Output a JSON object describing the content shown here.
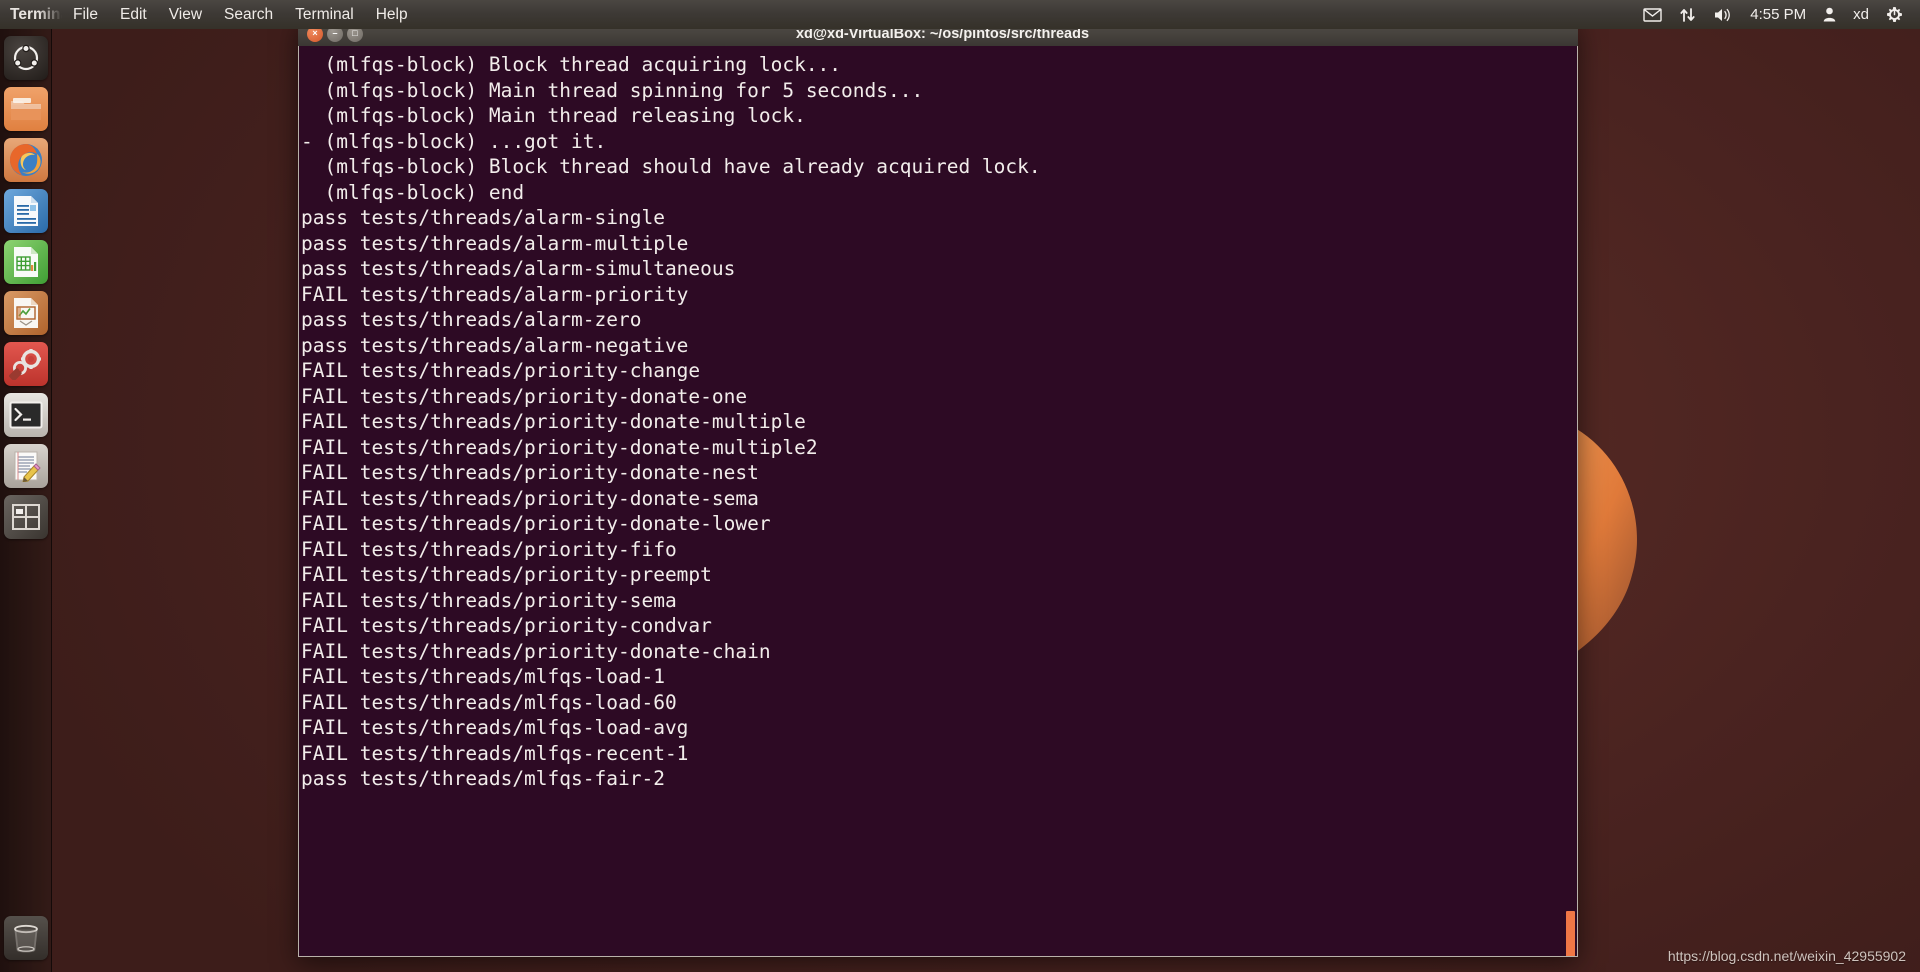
{
  "top_panel": {
    "app_name": "Terminal",
    "menus": [
      {
        "label": "File",
        "name": "menu-file"
      },
      {
        "label": "Edit",
        "name": "menu-edit"
      },
      {
        "label": "View",
        "name": "menu-view"
      },
      {
        "label": "Search",
        "name": "menu-search"
      },
      {
        "label": "Terminal",
        "name": "menu-terminal"
      },
      {
        "label": "Help",
        "name": "menu-help"
      }
    ],
    "tray": {
      "mail_icon": "envelope-icon",
      "network_icon": "network-updown-icon",
      "volume_icon": "volume-speaker-icon",
      "clock": "4:55 PM",
      "user_icon": "user-icon",
      "username": "xd",
      "session_icon": "gear-power-icon"
    }
  },
  "launcher": {
    "items": [
      {
        "name": "dash-home",
        "icon": "ubuntu-logo-icon",
        "label": "Dash Home"
      },
      {
        "name": "files",
        "icon": "folder-icon",
        "label": "Files"
      },
      {
        "name": "firefox",
        "icon": "firefox-icon",
        "label": "Firefox Web Browser"
      },
      {
        "name": "libreoffice-writer",
        "icon": "document-writer-icon",
        "label": "LibreOffice Writer"
      },
      {
        "name": "libreoffice-calc",
        "icon": "spreadsheet-calc-icon",
        "label": "LibreOffice Calc"
      },
      {
        "name": "libreoffice-impress",
        "icon": "presentation-impress-icon",
        "label": "LibreOffice Impress"
      },
      {
        "name": "system-settings",
        "icon": "gear-wrench-icon",
        "label": "System Settings"
      },
      {
        "name": "terminal",
        "icon": "terminal-prompt-icon",
        "label": "Terminal",
        "running": true,
        "focused": true
      },
      {
        "name": "text-editor",
        "icon": "pencil-document-icon",
        "label": "Text Editor",
        "running": true
      },
      {
        "name": "workspace-switcher",
        "icon": "workspace-grid-icon",
        "label": "Workspace Switcher"
      }
    ],
    "trash": {
      "name": "trash",
      "icon": "trash-bin-icon",
      "label": "Trash"
    }
  },
  "terminal": {
    "title": "xd@xd-VirtualBox: ~/os/pintos/src/threads",
    "buttons": {
      "close": "×",
      "minimize": "–",
      "maximize": "□"
    },
    "background_color": "#2d0a24",
    "text_color": "#f2edeb",
    "scrollbar_color": "#f07746",
    "lines": [
      "  (mlfqs-block) Block thread acquiring lock...",
      "  (mlfqs-block) Main thread spinning for 5 seconds...",
      "  (mlfqs-block) Main thread releasing lock.",
      "- (mlfqs-block) ...got it.",
      "  (mlfqs-block) Block thread should have already acquired lock.",
      "  (mlfqs-block) end",
      "pass tests/threads/alarm-single",
      "pass tests/threads/alarm-multiple",
      "pass tests/threads/alarm-simultaneous",
      "FAIL tests/threads/alarm-priority",
      "pass tests/threads/alarm-zero",
      "pass tests/threads/alarm-negative",
      "FAIL tests/threads/priority-change",
      "FAIL tests/threads/priority-donate-one",
      "FAIL tests/threads/priority-donate-multiple",
      "FAIL tests/threads/priority-donate-multiple2",
      "FAIL tests/threads/priority-donate-nest",
      "FAIL tests/threads/priority-donate-sema",
      "FAIL tests/threads/priority-donate-lower",
      "FAIL tests/threads/priority-fifo",
      "FAIL tests/threads/priority-preempt",
      "FAIL tests/threads/priority-sema",
      "FAIL tests/threads/priority-condvar",
      "FAIL tests/threads/priority-donate-chain",
      "FAIL tests/threads/mlfqs-load-1",
      "FAIL tests/threads/mlfqs-load-60",
      "FAIL tests/threads/mlfqs-load-avg",
      "FAIL tests/threads/mlfqs-recent-1",
      "pass tests/threads/mlfqs-fair-2"
    ]
  },
  "watermark": {
    "text": "https://blog.csdn.net/weixin_42955902"
  }
}
